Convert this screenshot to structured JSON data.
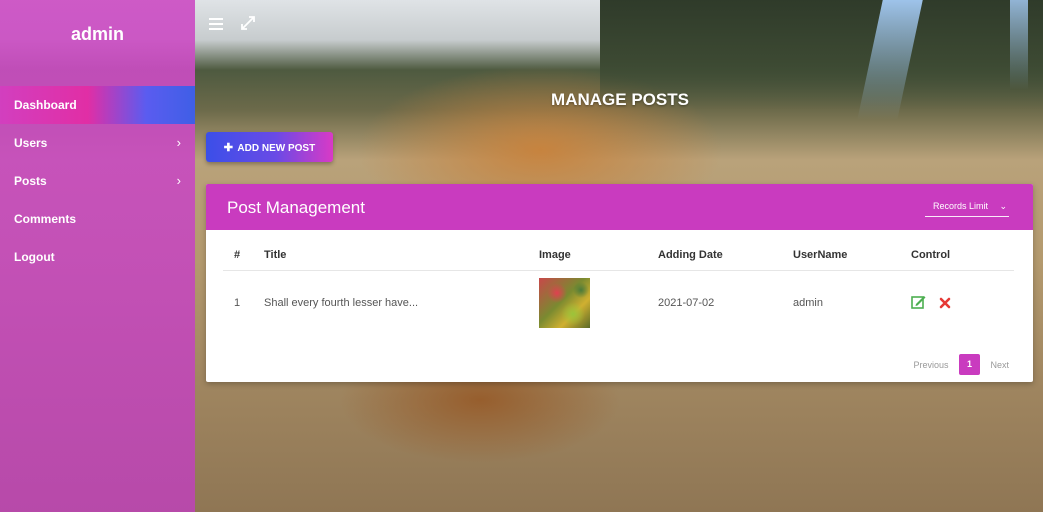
{
  "sidebar": {
    "brand": "admin",
    "items": [
      {
        "label": "Dashboard",
        "active": true,
        "has_submenu": false
      },
      {
        "label": "Users",
        "active": false,
        "has_submenu": true
      },
      {
        "label": "Posts",
        "active": false,
        "has_submenu": true
      },
      {
        "label": "Comments",
        "active": false,
        "has_submenu": false
      },
      {
        "label": "Logout",
        "active": false,
        "has_submenu": false
      }
    ]
  },
  "topbar": {
    "icons": [
      "menu-icon",
      "fullscreen-icon"
    ]
  },
  "page": {
    "heading": "MANAGE POSTS",
    "add_button_label": "ADD NEW POST"
  },
  "card": {
    "title": "Post Management",
    "records_limit_label": "Records Limit",
    "columns": [
      "#",
      "Title",
      "Image",
      "Adding Date",
      "UserName",
      "Control"
    ],
    "rows": [
      {
        "num": "1",
        "title": "Shall every fourth lesser have...",
        "date": "2021-07-02",
        "username": "admin"
      }
    ],
    "pagination": {
      "previous": "Previous",
      "current": "1",
      "next": "Next"
    }
  },
  "colors": {
    "accent": "#c93bbf",
    "button_start": "#3b4fe8",
    "edit": "#4caf50",
    "delete": "#e53935"
  }
}
